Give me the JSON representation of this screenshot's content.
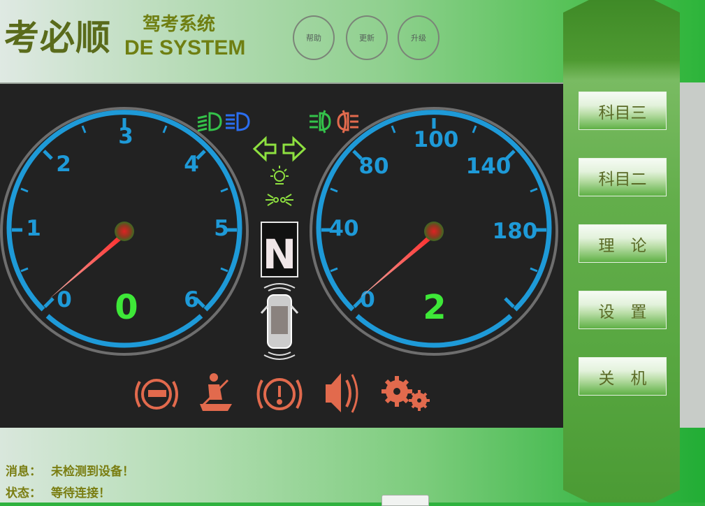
{
  "header": {
    "brand": "考必顺",
    "brand_cn": "驾考系统",
    "brand_en": "DE SYSTEM",
    "buttons": [
      "帮助",
      "更新",
      "升级"
    ]
  },
  "dashboard": {
    "tachometer": {
      "ticks": [
        "0",
        "1",
        "2",
        "3",
        "4",
        "5",
        "6"
      ],
      "reading": "0"
    },
    "speedometer": {
      "ticks": [
        "0",
        "40",
        "80",
        "100",
        "140",
        "180"
      ],
      "reading": "2"
    },
    "gear": "N",
    "indicator_icons": [
      "low-beam-icon",
      "high-beam-icon",
      "front-fog-icon",
      "rear-fog-icon",
      "turn-left-icon",
      "turn-right-icon",
      "position-light-icon",
      "clearance-light-icon",
      "car-sensor-icon"
    ],
    "warning_icons": [
      "parking-brake-icon",
      "seatbelt-icon",
      "warning-icon",
      "horn-icon",
      "gear-settings-icon"
    ],
    "colors": {
      "gauge_blue": "#1e9ad8",
      "needle_red": "#ff2a2a",
      "reading_green": "#3ee838",
      "warning_orange": "#e26a4d"
    }
  },
  "menu": {
    "items": [
      "科目三",
      "科目二",
      "理　论",
      "设　置",
      "关　机"
    ]
  },
  "status": {
    "message_label": "消息：",
    "message_value": "未检测到设备！",
    "state_label": "状态：",
    "state_value": "等待连接！"
  }
}
